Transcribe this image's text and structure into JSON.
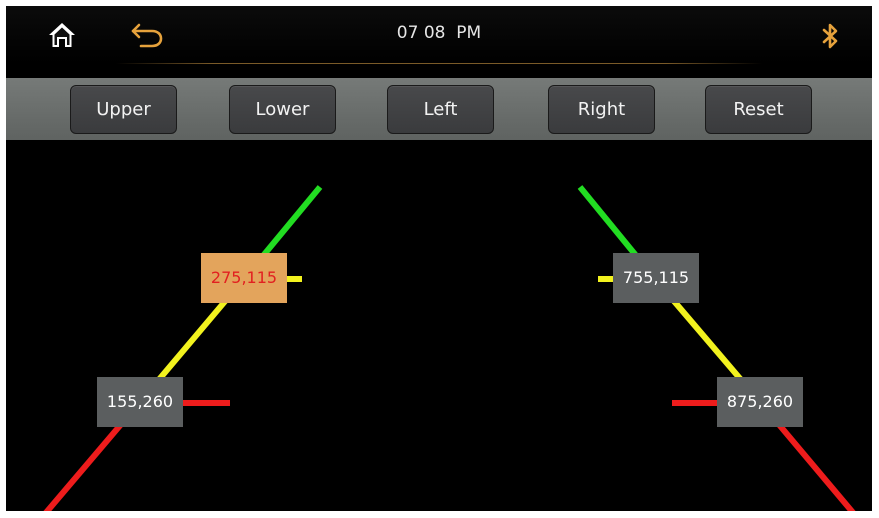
{
  "status_bar": {
    "clock": "07 08  PM",
    "icons": {
      "home": "home-icon",
      "back": "back-arrow-icon",
      "bluetooth": "bluetooth-icon"
    },
    "icon_color_home": "#ffffff",
    "icon_color_accent": "#e6a23c"
  },
  "toolbar": {
    "buttons": [
      {
        "label": "Upper"
      },
      {
        "label": "Lower"
      },
      {
        "label": "Left"
      },
      {
        "label": "Right"
      },
      {
        "label": "Reset"
      }
    ]
  },
  "parking_guides": {
    "colors": {
      "far": "#22dd22",
      "mid": "#f2f21e",
      "near": "#ee1c1c"
    },
    "points": [
      {
        "label": "275,115",
        "selected": true
      },
      {
        "label": "155,260",
        "selected": false
      },
      {
        "label": "755,115",
        "selected": false
      },
      {
        "label": "875,260",
        "selected": false
      }
    ]
  }
}
